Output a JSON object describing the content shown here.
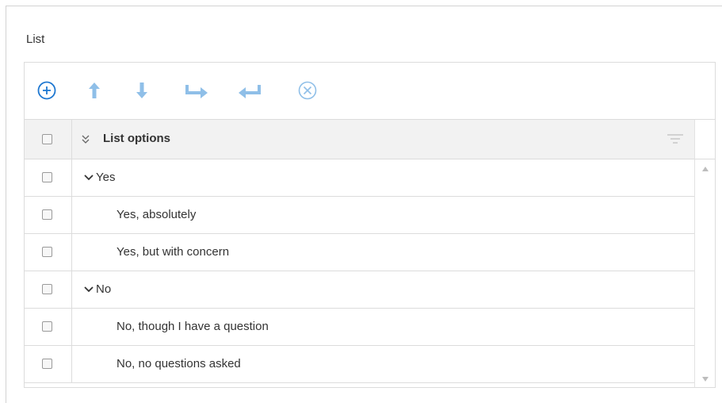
{
  "list": {
    "label": "List"
  },
  "toolbar": {
    "buttons": [
      {
        "icon": "add-circle-icon",
        "color": "#1f78d1"
      },
      {
        "icon": "arrow-up-icon",
        "color": "#8fbfe8"
      },
      {
        "icon": "arrow-down-icon",
        "color": "#8fbfe8"
      },
      {
        "icon": "indent-right-icon",
        "color": "#8fbfe8"
      },
      {
        "icon": "outdent-left-icon",
        "color": "#8fbfe8"
      },
      {
        "icon": "remove-circle-icon",
        "color": "#8fbfe8"
      }
    ]
  },
  "grid": {
    "header": {
      "label": "List options",
      "collapse_icon": "double-chevron-icon",
      "filter_icon": "filter-icon"
    },
    "rows": [
      {
        "text": "Yes",
        "level": 0,
        "expandable": true
      },
      {
        "text": "Yes, absolutely",
        "level": 1,
        "expandable": false
      },
      {
        "text": "Yes, but with concern",
        "level": 1,
        "expandable": false
      },
      {
        "text": "No",
        "level": 0,
        "expandable": true
      },
      {
        "text": "No, though I have a question",
        "level": 1,
        "expandable": false
      },
      {
        "text": "No, no questions asked",
        "level": 1,
        "expandable": false
      }
    ]
  },
  "colors": {
    "accent": "#1f78d1",
    "accent_disabled": "#8fbfe8",
    "header_bg": "#f2f2f2",
    "border": "#dcdcdc"
  }
}
